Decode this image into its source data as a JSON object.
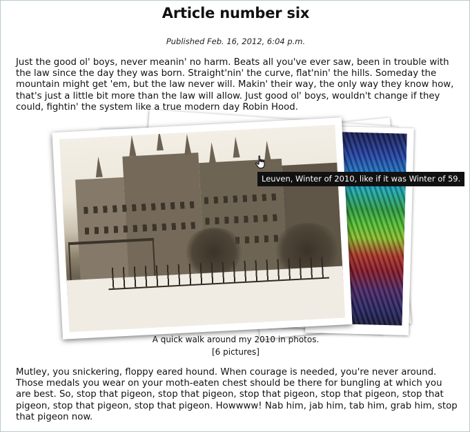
{
  "article": {
    "title": "Article number six",
    "published": "Published Feb. 16, 2012, 6:04 p.m.",
    "paragraph1": "Just the good ol' boys, never meanin' no harm. Beats all you've ever saw, been in trouble with the law since the day they was born. Straight'nin' the curve, flat'nin' the hills. Someday the mountain might get 'em, but the law never will. Makin' their way, the only way they know how, that's just a little bit more than the law will allow. Just good ol' boys, wouldn't change if they could, fightin' the system like a true modern day Robin Hood.",
    "paragraph2": "Mutley, you snickering, floppy eared hound. When courage is needed, you're never around. Those medals you wear on your moth-eaten chest should be there for bungling at which you are best. So, stop that pigeon, stop that pigeon, stop that pigeon, stop that pigeon, stop that pigeon, stop that pigeon, stop that pigeon. Howwww! Nab him, jab him, tab him, grab him, stop that pigeon now."
  },
  "gallery": {
    "tooltip": "Leuven, Winter of 2010, like if it was Winter of 59.",
    "caption": "A quick walk around my 2010 in photos.",
    "count_label": "[6 pictures]",
    "cursor": "hand-pointer-icon"
  }
}
